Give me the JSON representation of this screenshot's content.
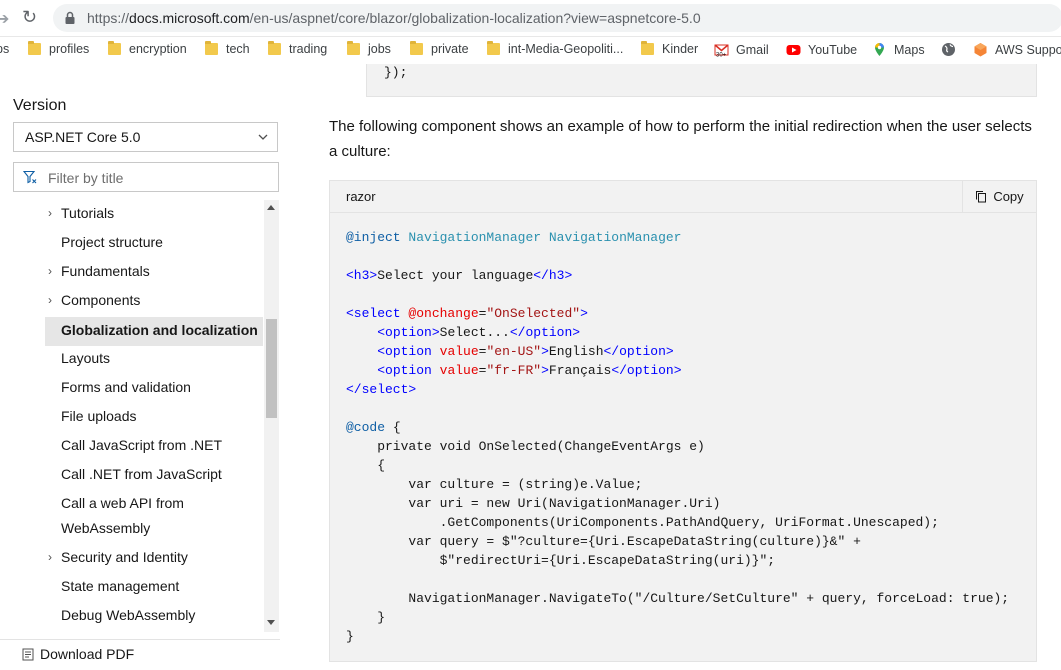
{
  "browser": {
    "url_prefix": "https://",
    "url_host": "docs.microsoft.com",
    "url_path": "/en-us/aspnet/core/blazor/globalization-localization?view=aspnetcore-5.0",
    "bookmarks": [
      {
        "label": "ps",
        "icon": "apps-fragment"
      },
      {
        "label": "profiles",
        "icon": "folder-icon"
      },
      {
        "label": "encryption",
        "icon": "folder-icon"
      },
      {
        "label": "tech",
        "icon": "folder-icon"
      },
      {
        "label": "trading",
        "icon": "folder-icon"
      },
      {
        "label": "jobs",
        "icon": "folder-icon"
      },
      {
        "label": "private",
        "icon": "folder-icon"
      },
      {
        "label": "int-Media-Geopoliti...",
        "icon": "folder-icon"
      },
      {
        "label": "Kinder",
        "icon": "folder-icon"
      },
      {
        "label": "Gmail",
        "icon": "gmail-icon"
      },
      {
        "label": "YouTube",
        "icon": "youtube-icon"
      },
      {
        "label": "Maps",
        "icon": "maps-icon"
      },
      {
        "label": "",
        "icon": "globe-icon"
      },
      {
        "label": "AWS Suppor",
        "icon": "aws-icon"
      }
    ]
  },
  "sidebar": {
    "version_label": "Version",
    "version_value": "ASP.NET Core 5.0",
    "filter_placeholder": "Filter by title",
    "items": [
      {
        "label": "Tutorials",
        "chevron": "›"
      },
      {
        "label": "Project structure",
        "chevron": ""
      },
      {
        "label": "Fundamentals",
        "chevron": "›"
      },
      {
        "label": "Components",
        "chevron": "›"
      },
      {
        "label": "Globalization and localization",
        "chevron": "",
        "active": true
      },
      {
        "label": "Layouts",
        "chevron": ""
      },
      {
        "label": "Forms and validation",
        "chevron": ""
      },
      {
        "label": "File uploads",
        "chevron": ""
      },
      {
        "label": "Call JavaScript from .NET",
        "chevron": ""
      },
      {
        "label": "Call .NET from JavaScript",
        "chevron": ""
      },
      {
        "label": "Call a web API from",
        "chevron": ""
      },
      {
        "label": "WebAssembly",
        "chevron": ""
      },
      {
        "label": "Security and Identity",
        "chevron": "›"
      },
      {
        "label": "State management",
        "chevron": ""
      },
      {
        "label": "Debug WebAssembly",
        "chevron": ""
      }
    ],
    "download_pdf": "Download PDF"
  },
  "main": {
    "prev_code_tail": "});",
    "paragraph": "The following component shows an example of how to perform the initial redirection when the user selects a culture:",
    "code_lang": "razor",
    "copy_label": "Copy"
  },
  "colors": {
    "keyword": "#0f5fa5",
    "tag": "#0000ff",
    "attribute": "#e50000",
    "string": "#a31515",
    "active_bg": "#e6e6e6"
  }
}
